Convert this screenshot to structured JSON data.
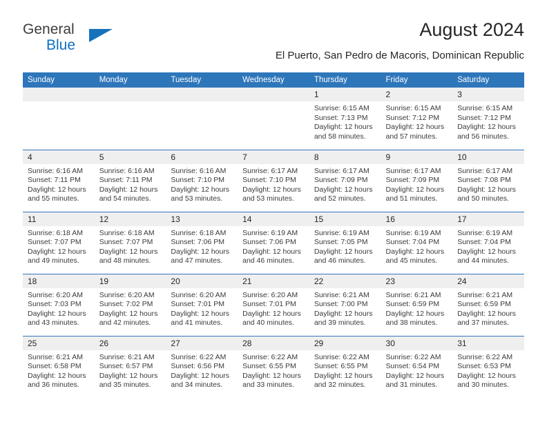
{
  "brand": {
    "line1": "General",
    "line2": "Blue",
    "flag_color": "#1572bb"
  },
  "header": {
    "title": "August 2024",
    "subtitle": "El Puerto, San Pedro de Macoris, Dominican Republic"
  },
  "theme": {
    "header_blue": "#2e76ba",
    "daynum_gray": "#efefef",
    "text": "#3a3a3a"
  },
  "calendar": {
    "weekday_headers": [
      "Sunday",
      "Monday",
      "Tuesday",
      "Wednesday",
      "Thursday",
      "Friday",
      "Saturday"
    ],
    "weeks": [
      [
        {
          "day": "",
          "empty": true
        },
        {
          "day": "",
          "empty": true
        },
        {
          "day": "",
          "empty": true
        },
        {
          "day": "",
          "empty": true
        },
        {
          "day": "1",
          "sunrise": "Sunrise: 6:15 AM",
          "sunset": "Sunset: 7:13 PM",
          "daylight": "Daylight: 12 hours and 58 minutes."
        },
        {
          "day": "2",
          "sunrise": "Sunrise: 6:15 AM",
          "sunset": "Sunset: 7:12 PM",
          "daylight": "Daylight: 12 hours and 57 minutes."
        },
        {
          "day": "3",
          "sunrise": "Sunrise: 6:15 AM",
          "sunset": "Sunset: 7:12 PM",
          "daylight": "Daylight: 12 hours and 56 minutes."
        }
      ],
      [
        {
          "day": "4",
          "sunrise": "Sunrise: 6:16 AM",
          "sunset": "Sunset: 7:11 PM",
          "daylight": "Daylight: 12 hours and 55 minutes."
        },
        {
          "day": "5",
          "sunrise": "Sunrise: 6:16 AM",
          "sunset": "Sunset: 7:11 PM",
          "daylight": "Daylight: 12 hours and 54 minutes."
        },
        {
          "day": "6",
          "sunrise": "Sunrise: 6:16 AM",
          "sunset": "Sunset: 7:10 PM",
          "daylight": "Daylight: 12 hours and 53 minutes."
        },
        {
          "day": "7",
          "sunrise": "Sunrise: 6:17 AM",
          "sunset": "Sunset: 7:10 PM",
          "daylight": "Daylight: 12 hours and 53 minutes."
        },
        {
          "day": "8",
          "sunrise": "Sunrise: 6:17 AM",
          "sunset": "Sunset: 7:09 PM",
          "daylight": "Daylight: 12 hours and 52 minutes."
        },
        {
          "day": "9",
          "sunrise": "Sunrise: 6:17 AM",
          "sunset": "Sunset: 7:09 PM",
          "daylight": "Daylight: 12 hours and 51 minutes."
        },
        {
          "day": "10",
          "sunrise": "Sunrise: 6:17 AM",
          "sunset": "Sunset: 7:08 PM",
          "daylight": "Daylight: 12 hours and 50 minutes."
        }
      ],
      [
        {
          "day": "11",
          "sunrise": "Sunrise: 6:18 AM",
          "sunset": "Sunset: 7:07 PM",
          "daylight": "Daylight: 12 hours and 49 minutes."
        },
        {
          "day": "12",
          "sunrise": "Sunrise: 6:18 AM",
          "sunset": "Sunset: 7:07 PM",
          "daylight": "Daylight: 12 hours and 48 minutes."
        },
        {
          "day": "13",
          "sunrise": "Sunrise: 6:18 AM",
          "sunset": "Sunset: 7:06 PM",
          "daylight": "Daylight: 12 hours and 47 minutes."
        },
        {
          "day": "14",
          "sunrise": "Sunrise: 6:19 AM",
          "sunset": "Sunset: 7:06 PM",
          "daylight": "Daylight: 12 hours and 46 minutes."
        },
        {
          "day": "15",
          "sunrise": "Sunrise: 6:19 AM",
          "sunset": "Sunset: 7:05 PM",
          "daylight": "Daylight: 12 hours and 46 minutes."
        },
        {
          "day": "16",
          "sunrise": "Sunrise: 6:19 AM",
          "sunset": "Sunset: 7:04 PM",
          "daylight": "Daylight: 12 hours and 45 minutes."
        },
        {
          "day": "17",
          "sunrise": "Sunrise: 6:19 AM",
          "sunset": "Sunset: 7:04 PM",
          "daylight": "Daylight: 12 hours and 44 minutes."
        }
      ],
      [
        {
          "day": "18",
          "sunrise": "Sunrise: 6:20 AM",
          "sunset": "Sunset: 7:03 PM",
          "daylight": "Daylight: 12 hours and 43 minutes."
        },
        {
          "day": "19",
          "sunrise": "Sunrise: 6:20 AM",
          "sunset": "Sunset: 7:02 PM",
          "daylight": "Daylight: 12 hours and 42 minutes."
        },
        {
          "day": "20",
          "sunrise": "Sunrise: 6:20 AM",
          "sunset": "Sunset: 7:01 PM",
          "daylight": "Daylight: 12 hours and 41 minutes."
        },
        {
          "day": "21",
          "sunrise": "Sunrise: 6:20 AM",
          "sunset": "Sunset: 7:01 PM",
          "daylight": "Daylight: 12 hours and 40 minutes."
        },
        {
          "day": "22",
          "sunrise": "Sunrise: 6:21 AM",
          "sunset": "Sunset: 7:00 PM",
          "daylight": "Daylight: 12 hours and 39 minutes."
        },
        {
          "day": "23",
          "sunrise": "Sunrise: 6:21 AM",
          "sunset": "Sunset: 6:59 PM",
          "daylight": "Daylight: 12 hours and 38 minutes."
        },
        {
          "day": "24",
          "sunrise": "Sunrise: 6:21 AM",
          "sunset": "Sunset: 6:59 PM",
          "daylight": "Daylight: 12 hours and 37 minutes."
        }
      ],
      [
        {
          "day": "25",
          "sunrise": "Sunrise: 6:21 AM",
          "sunset": "Sunset: 6:58 PM",
          "daylight": "Daylight: 12 hours and 36 minutes."
        },
        {
          "day": "26",
          "sunrise": "Sunrise: 6:21 AM",
          "sunset": "Sunset: 6:57 PM",
          "daylight": "Daylight: 12 hours and 35 minutes."
        },
        {
          "day": "27",
          "sunrise": "Sunrise: 6:22 AM",
          "sunset": "Sunset: 6:56 PM",
          "daylight": "Daylight: 12 hours and 34 minutes."
        },
        {
          "day": "28",
          "sunrise": "Sunrise: 6:22 AM",
          "sunset": "Sunset: 6:55 PM",
          "daylight": "Daylight: 12 hours and 33 minutes."
        },
        {
          "day": "29",
          "sunrise": "Sunrise: 6:22 AM",
          "sunset": "Sunset: 6:55 PM",
          "daylight": "Daylight: 12 hours and 32 minutes."
        },
        {
          "day": "30",
          "sunrise": "Sunrise: 6:22 AM",
          "sunset": "Sunset: 6:54 PM",
          "daylight": "Daylight: 12 hours and 31 minutes."
        },
        {
          "day": "31",
          "sunrise": "Sunrise: 6:22 AM",
          "sunset": "Sunset: 6:53 PM",
          "daylight": "Daylight: 12 hours and 30 minutes."
        }
      ]
    ]
  }
}
